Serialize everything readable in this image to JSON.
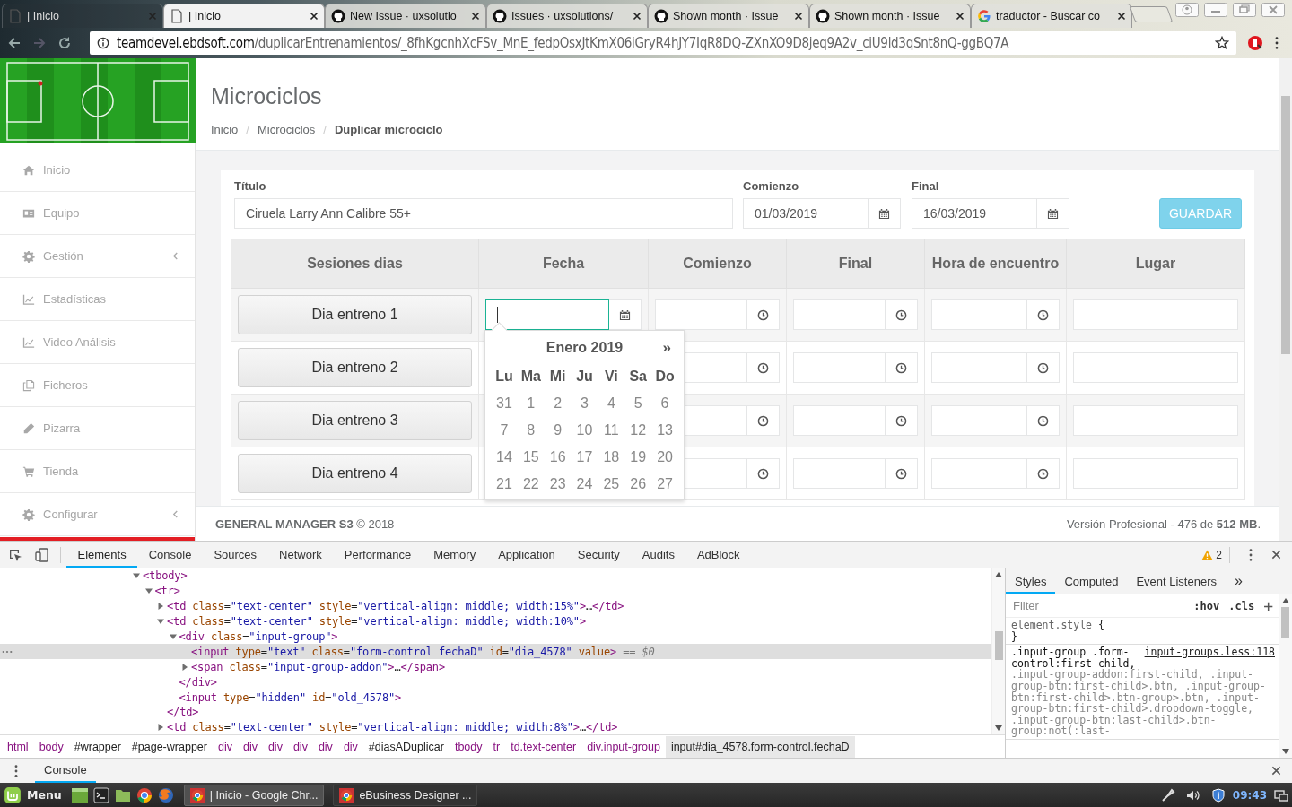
{
  "browser": {
    "tabs": [
      {
        "title": "| Inicio",
        "kind": "page",
        "selected": false
      },
      {
        "title": "| Inicio",
        "kind": "page",
        "selected": true
      },
      {
        "title": "New Issue · uxsolutio",
        "kind": "github",
        "selected": false
      },
      {
        "title": "Issues · uxsolutions/",
        "kind": "github",
        "selected": false
      },
      {
        "title": "Shown month · Issue",
        "kind": "github",
        "selected": false
      },
      {
        "title": "Shown month · Issue",
        "kind": "github",
        "selected": false
      },
      {
        "title": "traductor - Buscar co",
        "kind": "google",
        "selected": false
      }
    ],
    "url": {
      "host": "teamdevel.ebdsoft.com",
      "path": "/duplicarEntrenamientos/_8fhKgcnhXcFSv_MnE_fedpOsxJtKmX06iGryR4hJY7IqR8DQ-ZXnXO9D8jeq9A2v_ciU9ld3qSnt8nQ-ggBQ7A"
    }
  },
  "sidebar": {
    "items": [
      {
        "label": "Inicio",
        "submenu": false
      },
      {
        "label": "Equipo",
        "submenu": false
      },
      {
        "label": "Gestión",
        "submenu": true
      },
      {
        "label": "Estadísticas",
        "submenu": false
      },
      {
        "label": "Video Análisis",
        "submenu": false
      },
      {
        "label": "Ficheros",
        "submenu": false
      },
      {
        "label": "Pizarra",
        "submenu": false
      },
      {
        "label": "Tienda",
        "submenu": false
      },
      {
        "label": "Configurar",
        "submenu": true
      }
    ]
  },
  "page": {
    "title": "Microciclos",
    "breadcrumb_separator": "/",
    "breadcrumb": [
      {
        "label": "Inicio",
        "current": false
      },
      {
        "label": "Microciclos",
        "current": false
      },
      {
        "label": "Duplicar microciclo",
        "current": true
      }
    ]
  },
  "form": {
    "title_field": {
      "label": "Título",
      "value": "Ciruela Larry Ann Calibre 55+"
    },
    "date_fields": [
      {
        "label": "Comienzo",
        "value": "01/03/2019"
      },
      {
        "label": "Final",
        "value": "16/03/2019"
      }
    ],
    "save_button": "GUARDAR"
  },
  "table": {
    "columns": [
      "Sesiones dias",
      "Fecha",
      "Comienzo",
      "Final",
      "Hora de encuentro",
      "Lugar"
    ],
    "rows": [
      {
        "day": "Dia entreno 1",
        "date": {
          "focused": true
        }
      },
      {
        "day": "Dia entreno 2"
      },
      {
        "day": "Dia entreno 3"
      },
      {
        "day": "Dia entreno 4"
      }
    ]
  },
  "datepicker": {
    "title": "Enero 2019",
    "next": "»",
    "weekdays": [
      "Lu",
      "Ma",
      "Mi",
      "Ju",
      "Vi",
      "Sa",
      "Do"
    ],
    "weeks": [
      [
        "31",
        "1",
        "2",
        "3",
        "4",
        "5",
        "6"
      ],
      [
        "7",
        "8",
        "9",
        "10",
        "11",
        "12",
        "13"
      ],
      [
        "14",
        "15",
        "16",
        "17",
        "18",
        "19",
        "20"
      ],
      [
        "21",
        "22",
        "23",
        "24",
        "25",
        "26",
        "27"
      ]
    ]
  },
  "footer": {
    "left": "**GENERAL MANAGER S3** © 2018",
    "right": "Versión Profesional - 476 de **512 MB**."
  },
  "devtools": {
    "tabs": [
      {
        "label": "Elements",
        "selected": true
      },
      {
        "label": "Console",
        "selected": false
      },
      {
        "label": "Sources",
        "selected": false
      },
      {
        "label": "Network",
        "selected": false
      },
      {
        "label": "Performance",
        "selected": false
      },
      {
        "label": "Memory",
        "selected": false
      },
      {
        "label": "Application",
        "selected": false
      },
      {
        "label": "Security",
        "selected": false
      },
      {
        "label": "Audits",
        "selected": false
      },
      {
        "label": "AdBlock",
        "selected": false
      }
    ],
    "warning_count": "2",
    "dom": [
      {
        "kind": "parent",
        "text": "<tbody>",
        "expanded": true,
        "selected": false,
        "children": [
          {
            "kind": "parent",
            "text": "<tr>",
            "expanded": true,
            "selected": false,
            "children": [
              {
                "kind": "parent",
                "text": "<td class=\"text-center\" style=\"vertical-align: middle; width:15%\">…</td>",
                "expanded": false,
                "selected": false
              },
              {
                "kind": "parent",
                "text": "<td class=\"text-center\" style=\"vertical-align: middle; width:10%\">",
                "expanded": true,
                "selected": false,
                "close": "</td>",
                "children": [
                  {
                    "kind": "parent",
                    "text": "<div class=\"input-group\">",
                    "expanded": true,
                    "selected": false,
                    "close": "</div>",
                    "children": [
                      {
                        "kind": "leaf",
                        "text": "<input type=\"text\" class=\"form-control fechaD\" id=\"dia_4578\" value>",
                        "selected": true,
                        "suffix": "== $0"
                      },
                      {
                        "kind": "parent",
                        "text": "<span class=\"input-group-addon\">…</span>",
                        "expanded": false,
                        "selected": false
                      }
                    ]
                  },
                  {
                    "kind": "leaf",
                    "text": "<input type=\"hidden\" id=\"old_4578\">",
                    "selected": false
                  }
                ]
              },
              {
                "kind": "parent",
                "text": "<td class=\"text-center\" style=\"vertical-align: middle; width:8%\">…</td>",
                "expanded": false,
                "selected": false
              }
            ]
          }
        ]
      }
    ],
    "crumbs": [
      {
        "label": "html",
        "kind": "tag",
        "selected": false
      },
      {
        "label": "body",
        "kind": "tag",
        "selected": false
      },
      {
        "label": "#wrapper",
        "kind": "id",
        "selected": false
      },
      {
        "label": "#page-wrapper",
        "kind": "id",
        "selected": false
      },
      {
        "label": "div",
        "kind": "tag",
        "selected": false
      },
      {
        "label": "div",
        "kind": "tag",
        "selected": false
      },
      {
        "label": "div",
        "kind": "tag",
        "selected": false
      },
      {
        "label": "div",
        "kind": "tag",
        "selected": false
      },
      {
        "label": "div",
        "kind": "tag",
        "selected": false
      },
      {
        "label": "div",
        "kind": "tag",
        "selected": false
      },
      {
        "label": "#diasADuplicar",
        "kind": "id",
        "selected": false
      },
      {
        "label": "tbody",
        "kind": "tag",
        "selected": false
      },
      {
        "label": "tr",
        "kind": "tag",
        "selected": false
      },
      {
        "label": "td.text-center",
        "kind": "tag",
        "selected": false
      },
      {
        "label": "div.input-group",
        "kind": "tag",
        "selected": false
      },
      {
        "label": "input#dia_4578.form-control.fechaD",
        "kind": "tag",
        "selected": true
      }
    ],
    "styles": {
      "tabs": [
        {
          "label": "Styles",
          "selected": true
        },
        {
          "label": "Computed",
          "selected": false
        },
        {
          "label": "Event Listeners",
          "selected": false
        }
      ],
      "more": "»",
      "filter_placeholder": "Filter",
      "hov": ":hov",
      "cls": ".cls",
      "add": "+",
      "rules": [
        {
          "kind": "element",
          "selector": "element.style",
          "open": "{",
          "close": "}"
        },
        {
          "kind": "matched",
          "selector_match": ".input-group .form-control:first-child,",
          "selector_rest": ".input-group-addon:first-child, .input-group-btn:first-child>.btn, .input-group-btn:first-child>.btn-group>.btn, .input-group-btn:first-child>.dropdown-toggle, .input-group-btn:last-child>.btn-group:not(:last-",
          "source": "input-groups.less:118"
        }
      ]
    }
  },
  "drawer": {
    "tab": "Console"
  },
  "taskbar": {
    "menu": "Menu",
    "windows": [
      {
        "title": "| Inicio - Google Chr...",
        "selected": true
      },
      {
        "title": "eBusiness Designer ...",
        "selected": false
      }
    ],
    "clock": "09:43"
  }
}
